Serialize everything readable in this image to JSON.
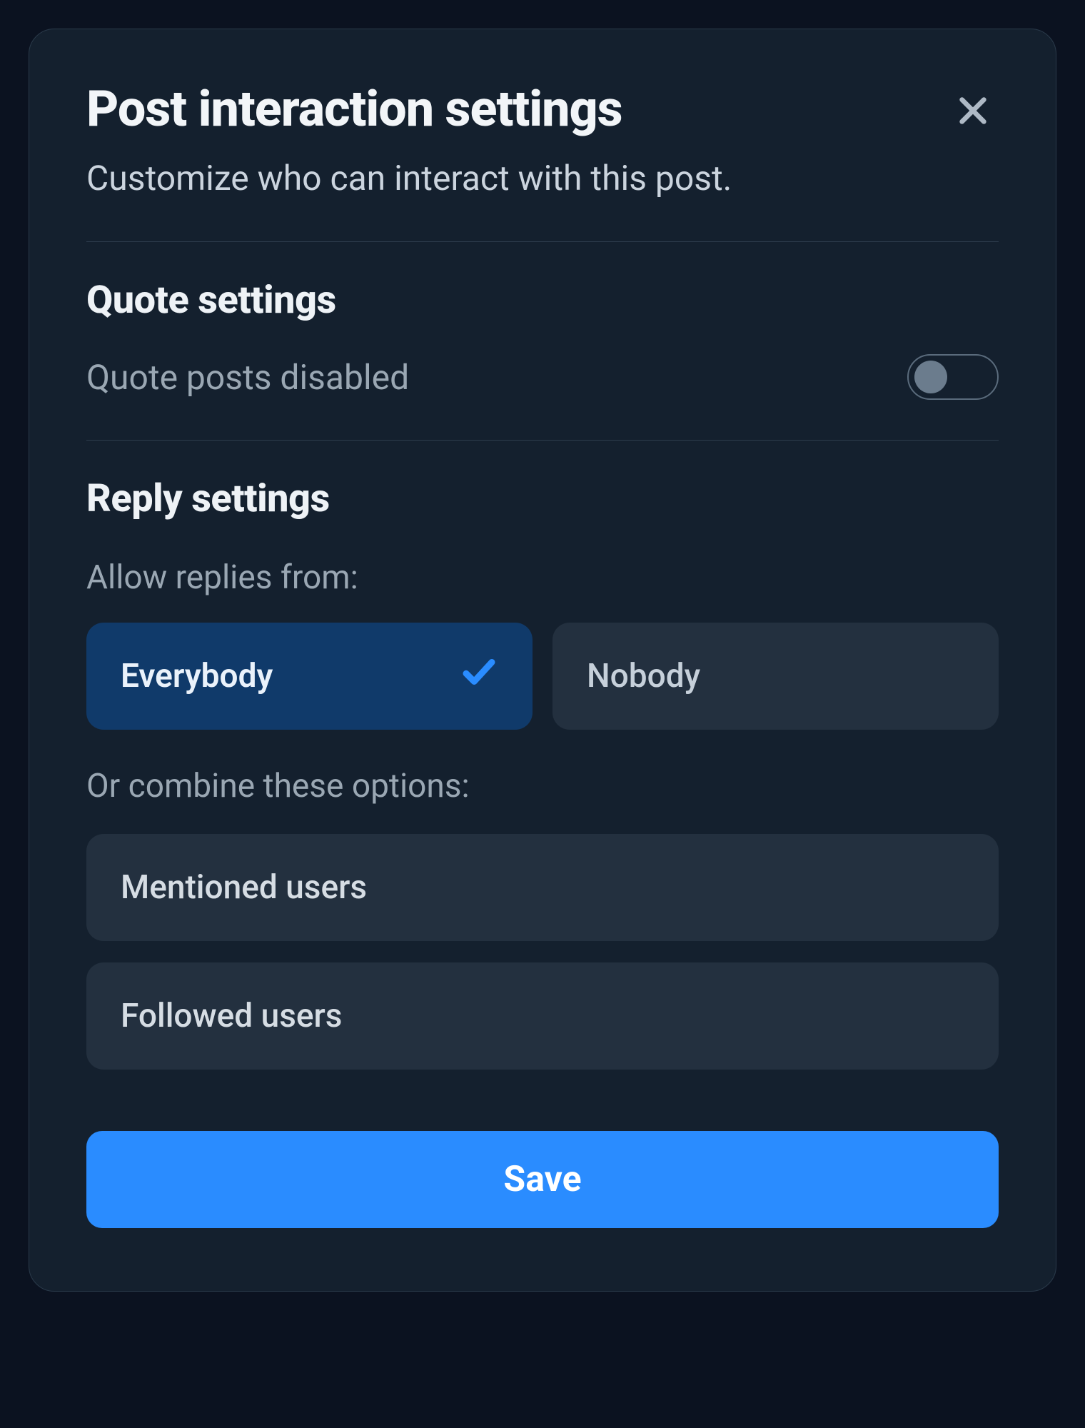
{
  "modal": {
    "title": "Post interaction settings",
    "subtitle": "Customize who can interact with this post."
  },
  "quote": {
    "section_title": "Quote settings",
    "toggle_label": "Quote posts disabled",
    "toggle_on": false
  },
  "reply": {
    "section_title": "Reply settings",
    "allow_label": "Allow replies from:",
    "primary_options": {
      "everybody": "Everybody",
      "nobody": "Nobody"
    },
    "selected_primary": "everybody",
    "combine_label": "Or combine these options:",
    "combine_options": {
      "mentioned": "Mentioned users",
      "followed": "Followed users"
    }
  },
  "actions": {
    "save_label": "Save"
  }
}
